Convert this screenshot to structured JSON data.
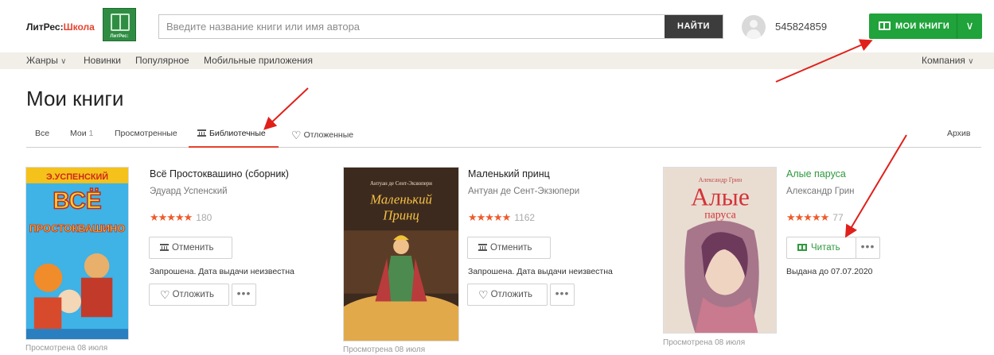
{
  "header": {
    "logo_main": "ЛитРес:",
    "logo_accent": "Школа",
    "logo_tile_text": "ЛитРес:",
    "search_placeholder": "Введите название книги или имя автора",
    "search_button": "НАЙТИ",
    "user_id": "545824859",
    "mybooks_label": "МОИ КНИГИ",
    "mybooks_caret": "∨"
  },
  "nav": {
    "genres": "Жанры",
    "new": "Новинки",
    "popular": "Популярное",
    "mobile": "Мобильные приложения",
    "company": "Компания",
    "caret": "∨"
  },
  "page": {
    "title": "Мои книги"
  },
  "tabs": {
    "all": "Все",
    "mine": "Мои",
    "mine_count": "1",
    "viewed": "Просмотренные",
    "library": "Библиотечные",
    "postponed": "Отложенные",
    "archive": "Архив"
  },
  "colors": {
    "accent_green": "#1fa33a",
    "accent_red": "#e5432e",
    "star_orange": "#ef5a2a",
    "arrow_red": "#e0201b"
  },
  "books": [
    {
      "title": "Всё Простоквашино (сборник)",
      "author": "Эдуард Успенский",
      "stars": "★★★★★",
      "votes": "180",
      "action": "Отменить",
      "status": "Запрошена. Дата выдачи неизвестна",
      "secondary": "Отложить",
      "viewed": "Просмотрена 08 июля",
      "cover_author": "Э.УСПЕНСКИЙ",
      "cover_title1": "ВСЁ",
      "cover_title2": "ПРОСТОКВАШИНО"
    },
    {
      "title": "Маленький принц",
      "author": "Антуан де Сент-Экзюпери",
      "stars": "★★★★★",
      "votes": "1162",
      "action": "Отменить",
      "status": "Запрошена. Дата выдачи неизвестна",
      "secondary": "Отложить",
      "viewed": "Просмотрена 08 июля",
      "cover_author": "Антуан де Сент-Экзюпери",
      "cover_title1": "Маленький",
      "cover_title2": "Принц"
    },
    {
      "title": "Алые паруса",
      "author": "Александр Грин",
      "stars": "★★★★★",
      "votes": "77",
      "action": "Читать",
      "status": "Выдана до 07.07.2020",
      "viewed": "Просмотрена 08 июля",
      "cover_author": "Александр Грин",
      "cover_title1": "Алые",
      "cover_title2": "паруса"
    }
  ],
  "icons": {
    "more": "•••",
    "heart": "♡"
  }
}
